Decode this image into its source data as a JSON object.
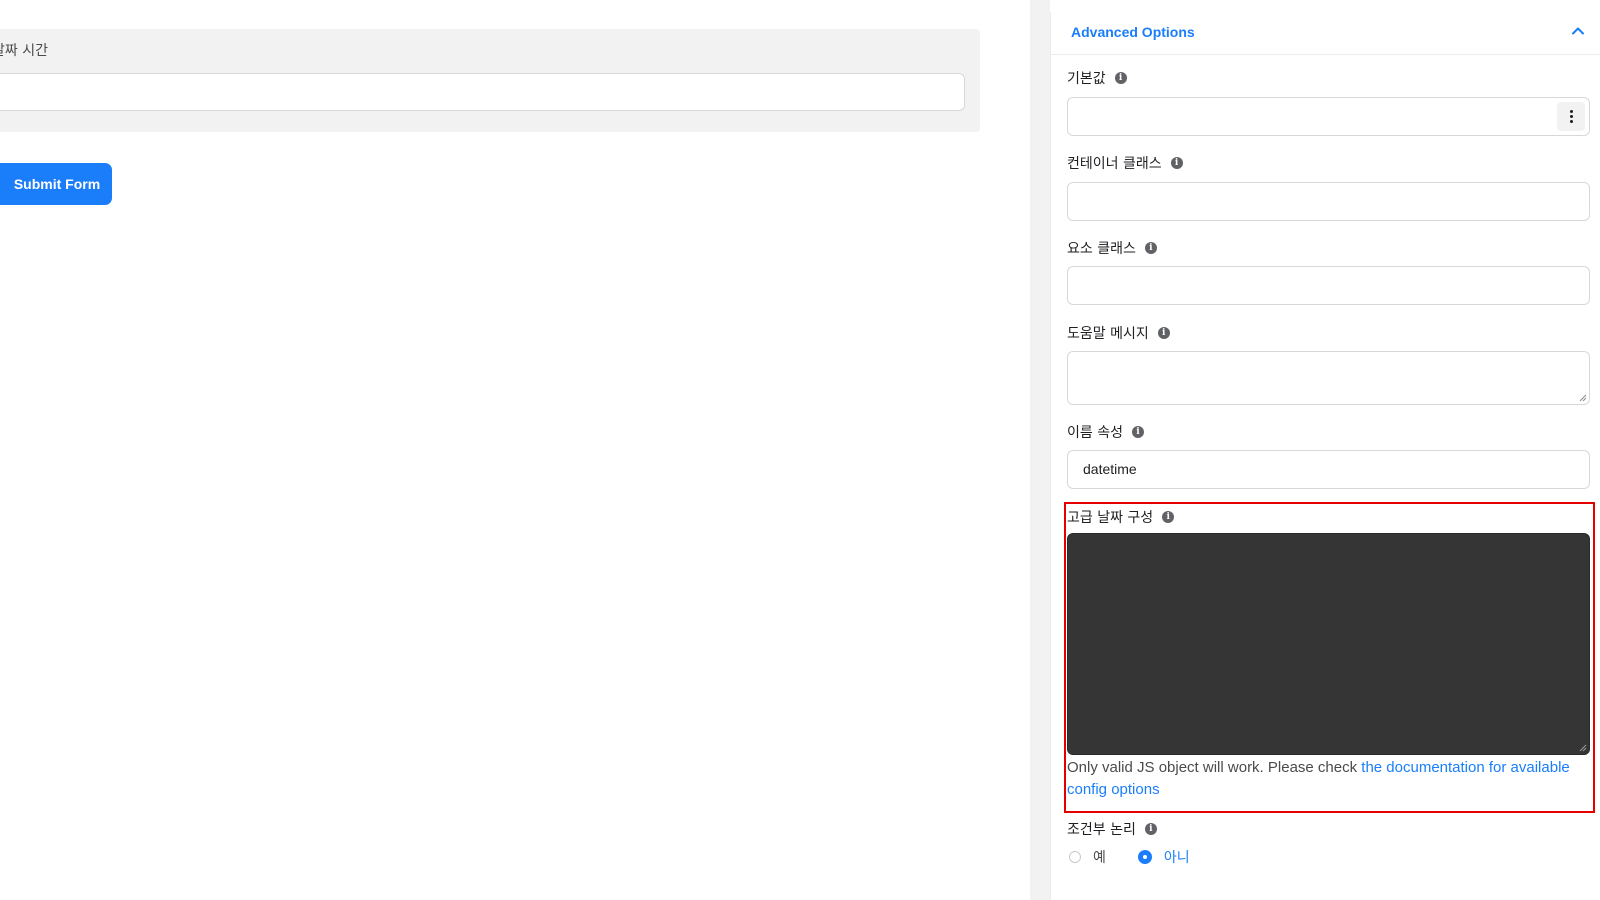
{
  "canvas": {
    "field_label": "날짜 시간",
    "submit_label": "Submit Form"
  },
  "panel": {
    "title": "Advanced Options",
    "fields": {
      "default_value": {
        "label": "기본값",
        "value": ""
      },
      "container_class": {
        "label": "컨테이너 클래스",
        "value": ""
      },
      "element_class": {
        "label": "요소 클래스",
        "value": ""
      },
      "help_message": {
        "label": "도움말 메시지",
        "value": ""
      },
      "name_attribute": {
        "label": "이름 속성",
        "value": "datetime"
      },
      "advanced_date_config": {
        "label": "고급 날짜 구성",
        "help_prefix": "Only valid JS object will work. Please check ",
        "help_link": "the documentation for available config options"
      },
      "conditional_logic": {
        "label": "조건부 논리",
        "options": [
          "예",
          "아니"
        ],
        "selected": "아니"
      }
    }
  },
  "colors": {
    "accent": "#1a7efb",
    "editor_bg": "#353535",
    "highlight": "#e50000"
  },
  "icons": {
    "info": "info-icon",
    "collapse": "chevron-up-icon",
    "menu": "kebab-menu-icon"
  }
}
